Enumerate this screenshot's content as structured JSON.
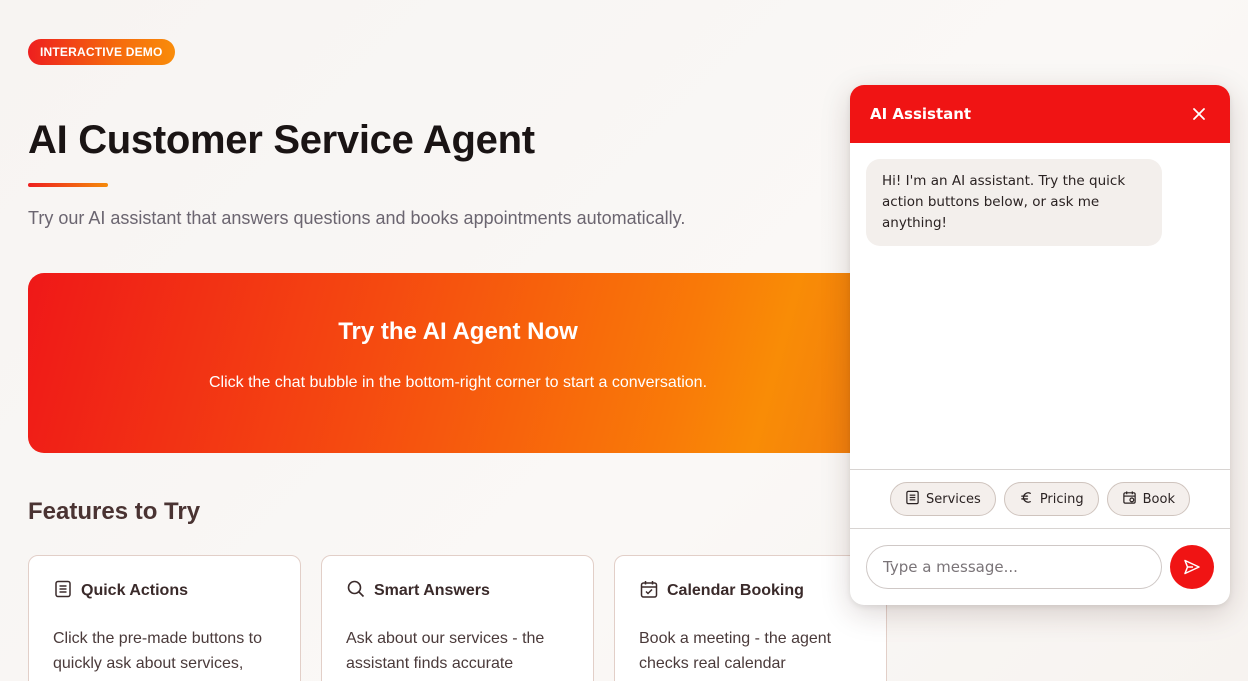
{
  "badge": {
    "label": "INTERACTIVE DEMO"
  },
  "page": {
    "title": "AI Customer Service Agent",
    "subtitle": "Try our AI assistant that answers questions and books appointments automatically."
  },
  "hero": {
    "title": "Try the AI Agent Now",
    "text": "Click the chat bubble in the bottom-right corner to start a conversation."
  },
  "features": {
    "heading": "Features to Try",
    "cards": [
      {
        "icon": "list-icon",
        "title": "Quick Actions",
        "text": "Click the pre-made buttons to quickly ask about services,"
      },
      {
        "icon": "search-icon",
        "title": "Smart Answers",
        "text": "Ask about our services - the assistant finds accurate"
      },
      {
        "icon": "calendar-check-icon",
        "title": "Calendar Booking",
        "text": "Book a meeting - the agent checks real calendar"
      }
    ]
  },
  "chat": {
    "title": "AI Assistant",
    "messages": [
      {
        "from": "assistant",
        "text": "Hi! I'm an AI assistant. Try the quick action buttons below, or ask me anything!"
      }
    ],
    "quick_actions": [
      {
        "icon": "list-icon",
        "label": "Services"
      },
      {
        "icon": "euro-icon",
        "label": "Pricing"
      },
      {
        "icon": "calendar-icon",
        "label": "Book"
      }
    ],
    "input": {
      "placeholder": "Type a message...",
      "value": ""
    }
  },
  "colors": {
    "brand_red": "#f01414",
    "brand_orange": "#f98c0a",
    "heading_dark": "#1a1414",
    "muted_text": "#6b6570"
  }
}
